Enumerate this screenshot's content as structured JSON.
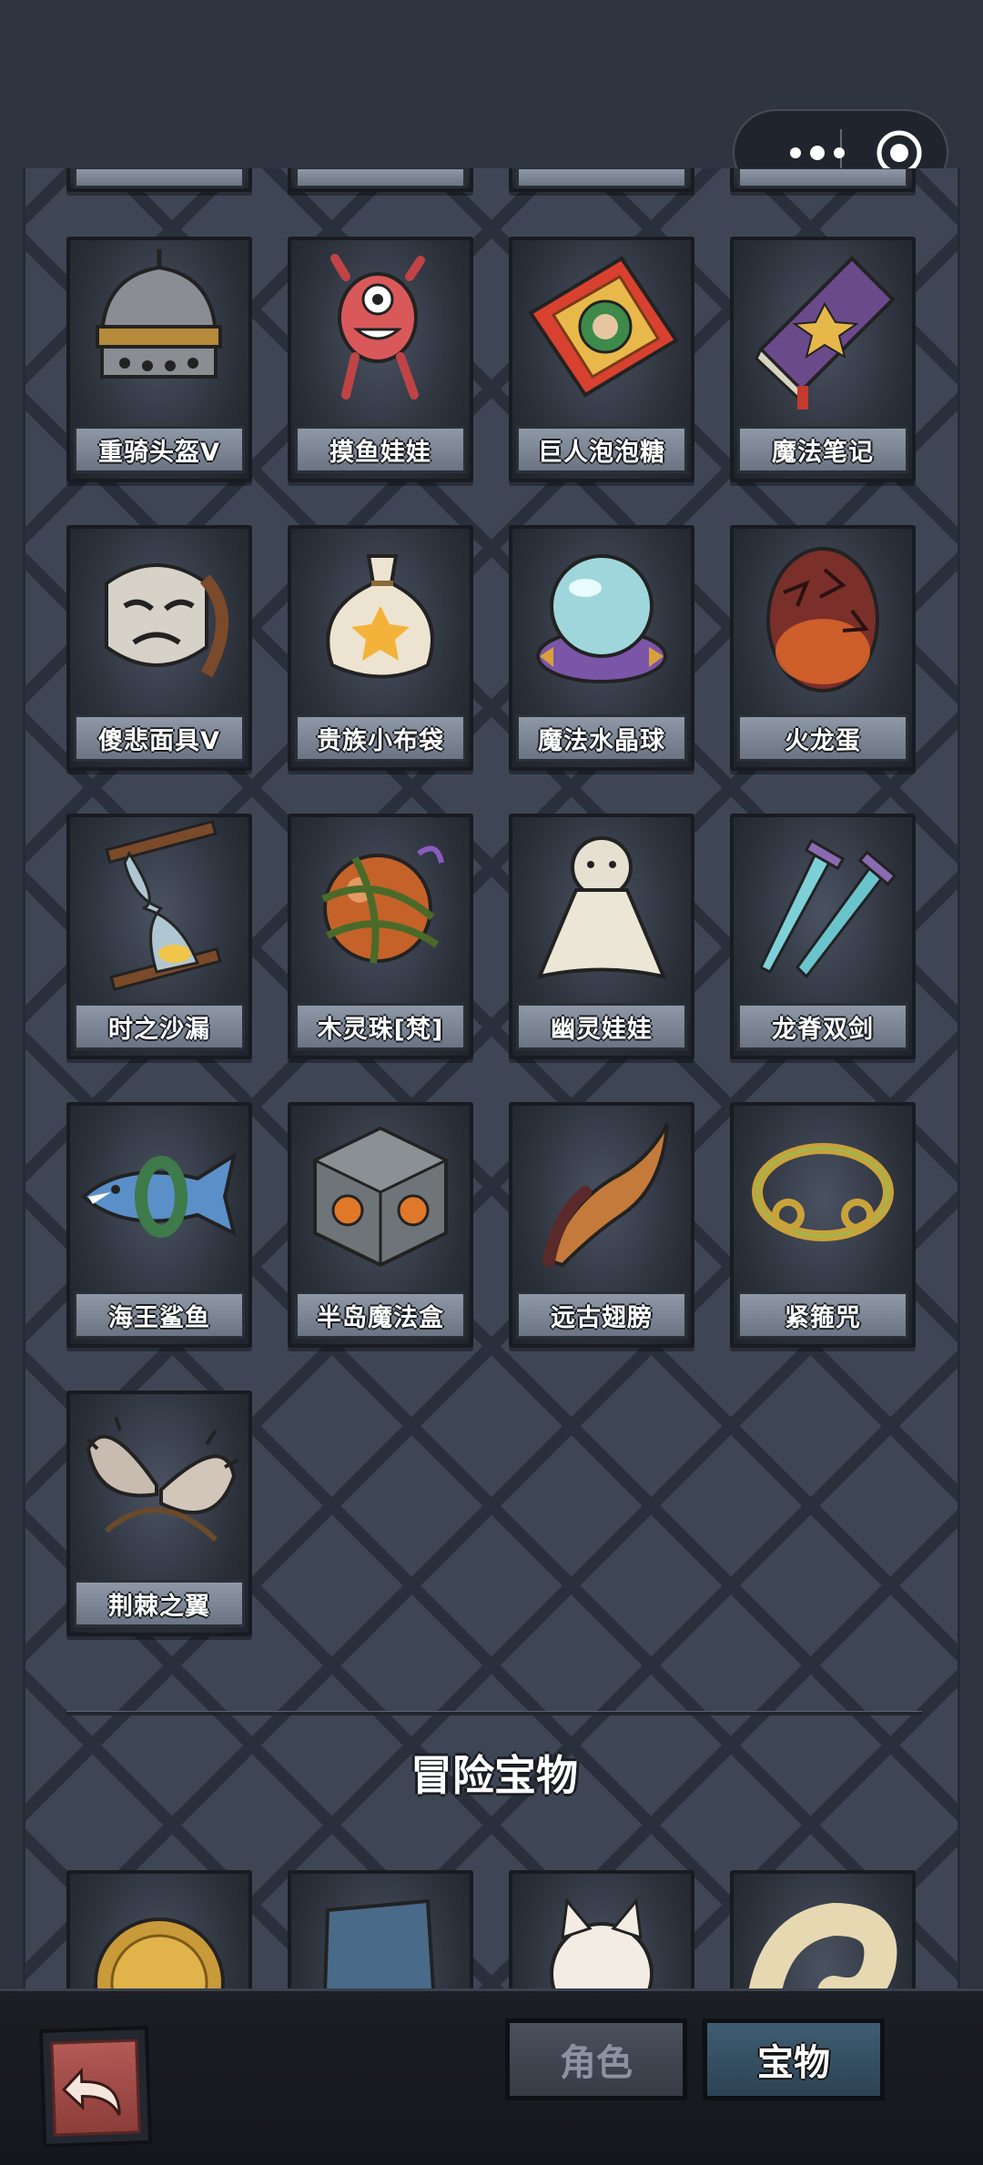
{
  "capsule": {
    "more_icon": "more-dots-icon",
    "close_icon": "target-circle-icon"
  },
  "items": [
    {
      "label": "重骑头盔V",
      "icon": "knight-helmet-icon"
    },
    {
      "label": "摸鱼娃娃",
      "icon": "red-doll-icon"
    },
    {
      "label": "巨人泡泡糖",
      "icon": "bubblegum-pack-icon"
    },
    {
      "label": "魔法笔记",
      "icon": "magic-notebook-icon"
    },
    {
      "label": "傻悲面具V",
      "icon": "sad-mask-icon"
    },
    {
      "label": "贵族小布袋",
      "icon": "cloth-bag-icon"
    },
    {
      "label": "魔法水晶球",
      "icon": "crystal-ball-icon"
    },
    {
      "label": "火龙蛋",
      "icon": "dragon-egg-icon"
    },
    {
      "label": "时之沙漏",
      "icon": "hourglass-icon"
    },
    {
      "label": "木灵珠[梵]",
      "icon": "wood-orb-icon"
    },
    {
      "label": "幽灵娃娃",
      "icon": "ghost-doll-icon"
    },
    {
      "label": "龙脊双剑",
      "icon": "twin-swords-icon"
    },
    {
      "label": "海王鲨鱼",
      "icon": "shark-icon"
    },
    {
      "label": "半岛魔法盒",
      "icon": "magic-box-icon"
    },
    {
      "label": "远古翅膀",
      "icon": "ancient-wing-icon"
    },
    {
      "label": "紧箍咒",
      "icon": "golden-band-icon"
    },
    {
      "label": "荆棘之翼",
      "icon": "thorn-wings-icon"
    }
  ],
  "section_title": "冒险宝物",
  "bottom_items": [
    {
      "icon": "gold-coin-icon"
    },
    {
      "icon": "blue-armor-icon"
    },
    {
      "icon": "lucky-cat-icon"
    },
    {
      "icon": "bone-horn-icon"
    }
  ],
  "tabs": {
    "role": "角色",
    "treasure": "宝物",
    "back_icon": "back-arrow-icon"
  }
}
